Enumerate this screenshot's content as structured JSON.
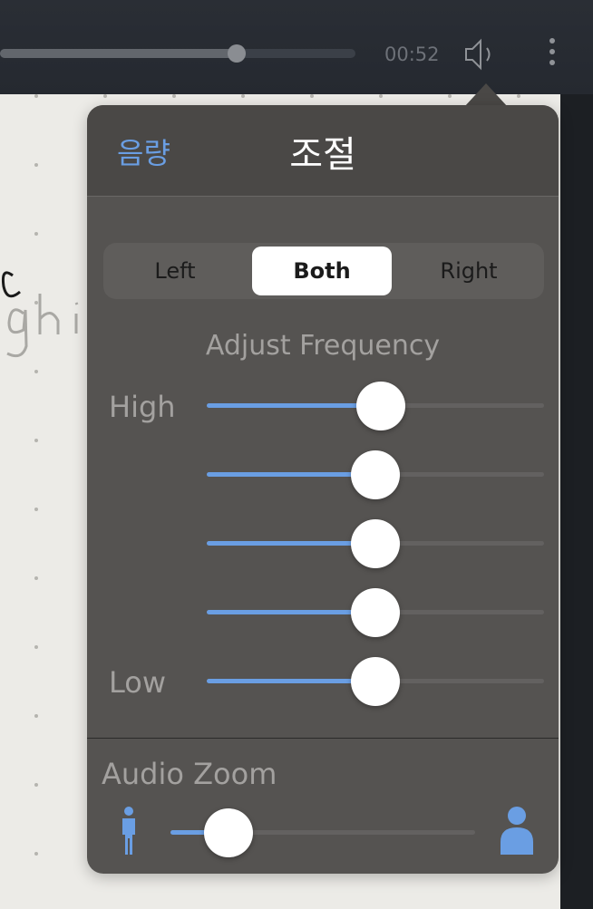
{
  "player": {
    "time": "00:52",
    "progress": 0.667
  },
  "popover": {
    "back_label": "음량",
    "title": "조절",
    "segments": [
      {
        "label": "Left",
        "selected": false
      },
      {
        "label": "Both",
        "selected": true
      },
      {
        "label": "Right",
        "selected": false
      }
    ],
    "frequency_title": "Adjust Frequency",
    "high_label": "High",
    "low_label": "Low",
    "frequency_levels": [
      0.515,
      0.5,
      0.5,
      0.5,
      0.5
    ],
    "zoom_title": "Audio Zoom",
    "zoom_level": 0.19
  },
  "colors": {
    "accent": "#6a9ee3",
    "panel": "#555351",
    "header": "#4a4846"
  },
  "icons": {
    "speaker": "speaker-icon",
    "more": "more-vertical-icon",
    "person_small": "person-small-icon",
    "person_large": "person-large-icon"
  }
}
